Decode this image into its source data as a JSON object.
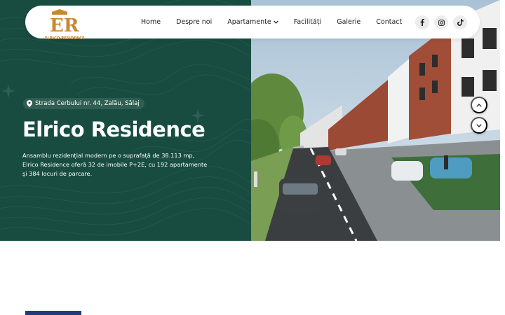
{
  "brand": {
    "logo_text": "ELRICO RESIDENCE",
    "accent_color": "#184c40",
    "logo_color": "#c8882f"
  },
  "nav": {
    "items": [
      {
        "label": "Home"
      },
      {
        "label": "Despre noi"
      },
      {
        "label": "Apartamente",
        "dropdown": true
      },
      {
        "label": "Facilități"
      },
      {
        "label": "Galerie"
      },
      {
        "label": "Contact"
      }
    ]
  },
  "socials": [
    {
      "icon": "facebook-icon"
    },
    {
      "icon": "instagram-icon"
    },
    {
      "icon": "tiktok-icon"
    }
  ],
  "hero": {
    "address": "Strada Cerbului nr. 44, Zalău, Sălaj",
    "title": "Elrico Residence",
    "description": "Ansamblu rezidențial modern pe o suprafață de 38.113 mp, Elrico Residence oferă 32 de imobile P+2E, cu 192 apartamente și 384 locuri de parcare."
  }
}
